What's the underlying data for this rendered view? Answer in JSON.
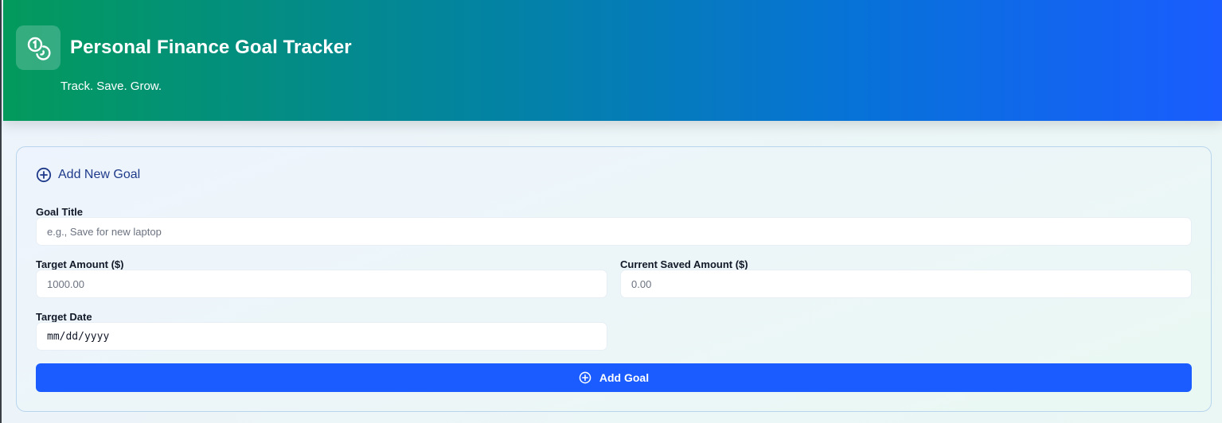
{
  "header": {
    "title": "Personal Finance Goal Tracker",
    "subtitle": "Track. Save. Grow.",
    "logo_icon": "coins-icon",
    "gradient_colors": [
      "#039a5c",
      "#1a5cff"
    ]
  },
  "form": {
    "title": "Add New Goal",
    "title_icon": "plus-circle-icon",
    "fields": {
      "goal_title": {
        "label": "Goal Title",
        "placeholder": "e.g., Save for new laptop",
        "value": ""
      },
      "target_amount": {
        "label": "Target Amount ($)",
        "placeholder": "1000.00",
        "value": ""
      },
      "current_saved": {
        "label": "Current Saved Amount ($)",
        "placeholder": "0.00",
        "value": ""
      },
      "target_date": {
        "label": "Target Date",
        "placeholder": "mm/dd/yyyy",
        "value": ""
      }
    },
    "submit": {
      "label": "Add Goal",
      "icon": "plus-circle-icon",
      "color": "#1a5cff"
    }
  }
}
